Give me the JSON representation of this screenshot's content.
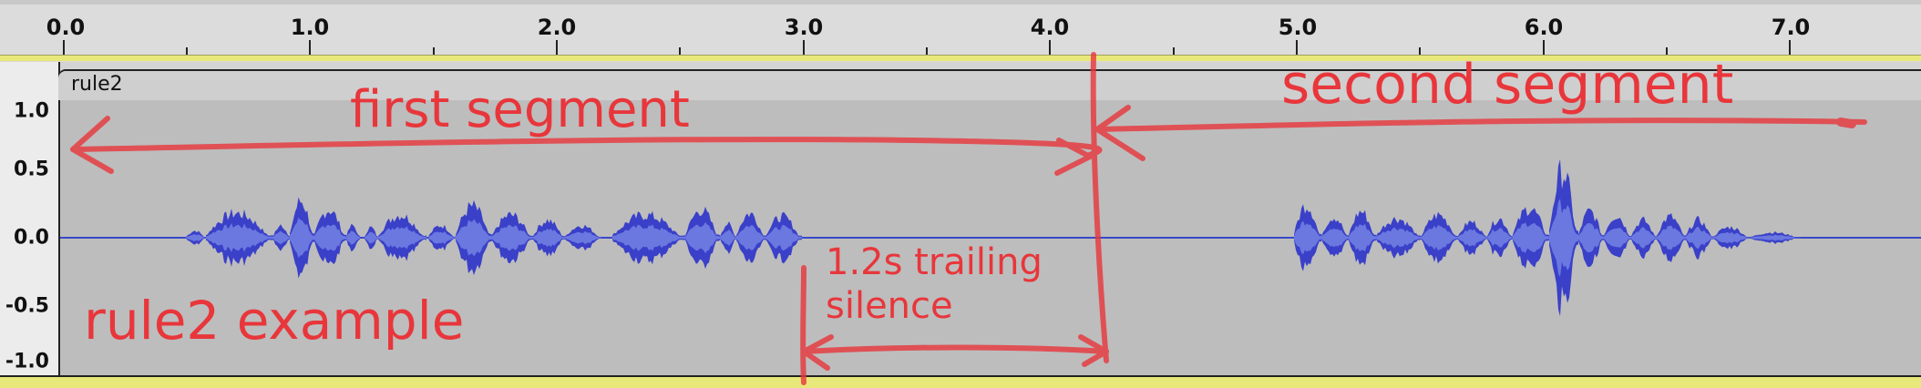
{
  "ruler": {
    "labels": [
      "0.0",
      "1.0",
      "2.0",
      "3.0",
      "4.0",
      "5.0",
      "6.0",
      "7.0"
    ]
  },
  "vertical_ruler": {
    "labels": [
      "1.0",
      "0.5",
      "0.0",
      "-0.5",
      "-1.0"
    ]
  },
  "track": {
    "clip_name": "rule2"
  },
  "annotations": {
    "first_segment": "first segment",
    "second_segment": "second segment",
    "example_label": "rule2 example",
    "silence_line1": "1.2s trailing",
    "silence_line2": "silence"
  },
  "colors": {
    "waveform_outer": "#3a40c8",
    "waveform_inner": "#6a78e0",
    "annotation": "#e8363b",
    "center_line": "#3848c8"
  }
}
